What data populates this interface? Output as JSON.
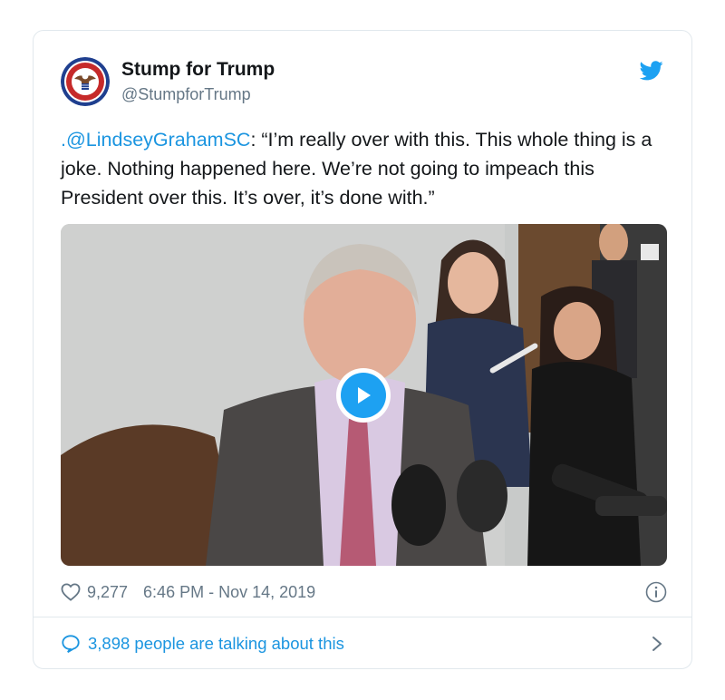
{
  "author": {
    "name": "Stump for Trump",
    "handle": "@StumpforTrump",
    "avatar_icon": "eagle-seal-icon"
  },
  "tweet": {
    "mention": ".@LindseyGrahamSC",
    "text": ": “I’m really over with this. This whole thing is a joke. Nothing happened here. We’re not going to impeach this President over this. It’s over, it’s done with.”"
  },
  "media": {
    "type": "video",
    "play_icon": "play-icon"
  },
  "meta": {
    "like_count": "9,277",
    "timestamp": "6:46 PM - Nov 14, 2019",
    "info_icon": "info-icon"
  },
  "footer": {
    "talking": "3,898 people are talking about this"
  },
  "colors": {
    "twitter_blue": "#1da1f2",
    "link_blue": "#1b95e0",
    "secondary_text": "#657786",
    "border": "#e1e8ed"
  }
}
